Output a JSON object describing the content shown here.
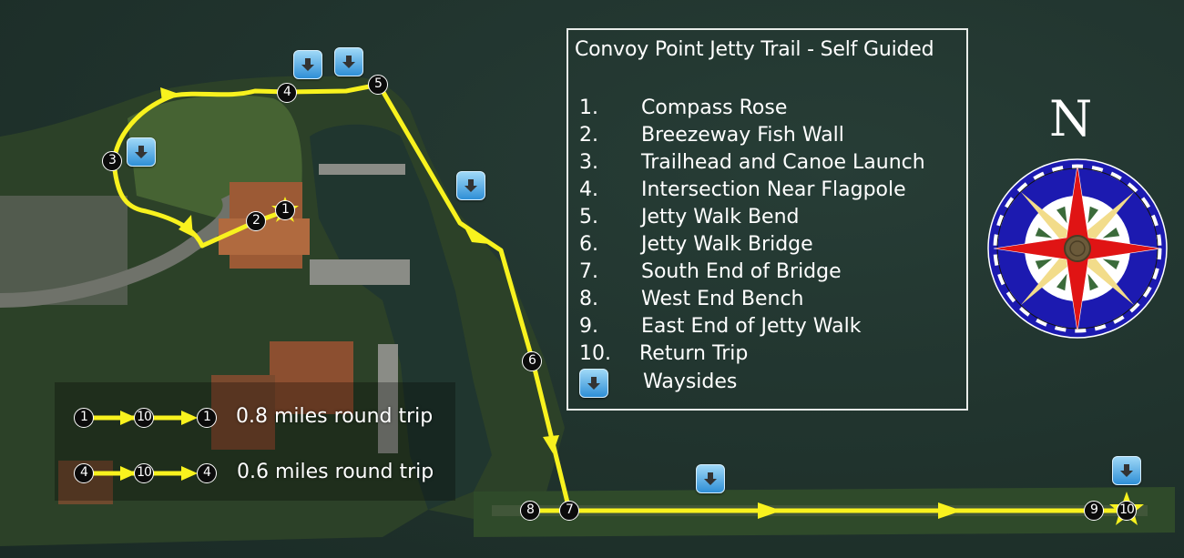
{
  "legend": {
    "title": "Convoy Point Jetty Trail - Self Guided",
    "stops": [
      {
        "num": "1.",
        "label": "Compass Rose"
      },
      {
        "num": "2.",
        "label": "Breezeway Fish Wall"
      },
      {
        "num": "3.",
        "label": "Trailhead and Canoe Launch"
      },
      {
        "num": "4.",
        "label": "Intersection Near Flagpole"
      },
      {
        "num": "5.",
        "label": "Jetty Walk Bend"
      },
      {
        "num": "6.",
        "label": "Jetty Walk Bridge"
      },
      {
        "num": "7.",
        "label": "South End of Bridge"
      },
      {
        "num": "8.",
        "label": "West End Bench"
      },
      {
        "num": "9.",
        "label": "East End of Jetty Walk"
      },
      {
        "num": "10.",
        "label": "Return Trip"
      }
    ],
    "wayside_label": "Waysides",
    "wayside_icon": "down-arrow-icon"
  },
  "compass": {
    "north_label": "N",
    "colors": {
      "ring": "#1c1ab0",
      "points_main": "#e01414",
      "points_secondary": "#f2dc8a",
      "leaves": "#3b6b3a",
      "hub": "#6b5a3a"
    }
  },
  "routes": [
    {
      "stops": [
        "1",
        "10",
        "1"
      ],
      "text": "0.8 miles round trip"
    },
    {
      "stops": [
        "4",
        "10",
        "4"
      ],
      "text": "0.6 miles round trip"
    }
  ],
  "map_markers": [
    "1",
    "2",
    "3",
    "4",
    "5",
    "6",
    "7",
    "8",
    "9",
    "10"
  ],
  "colors": {
    "trail": "#f8f21e",
    "water": "#1f332d",
    "land": "#2d4a2a",
    "wayside_blue": "#3a9be0"
  }
}
